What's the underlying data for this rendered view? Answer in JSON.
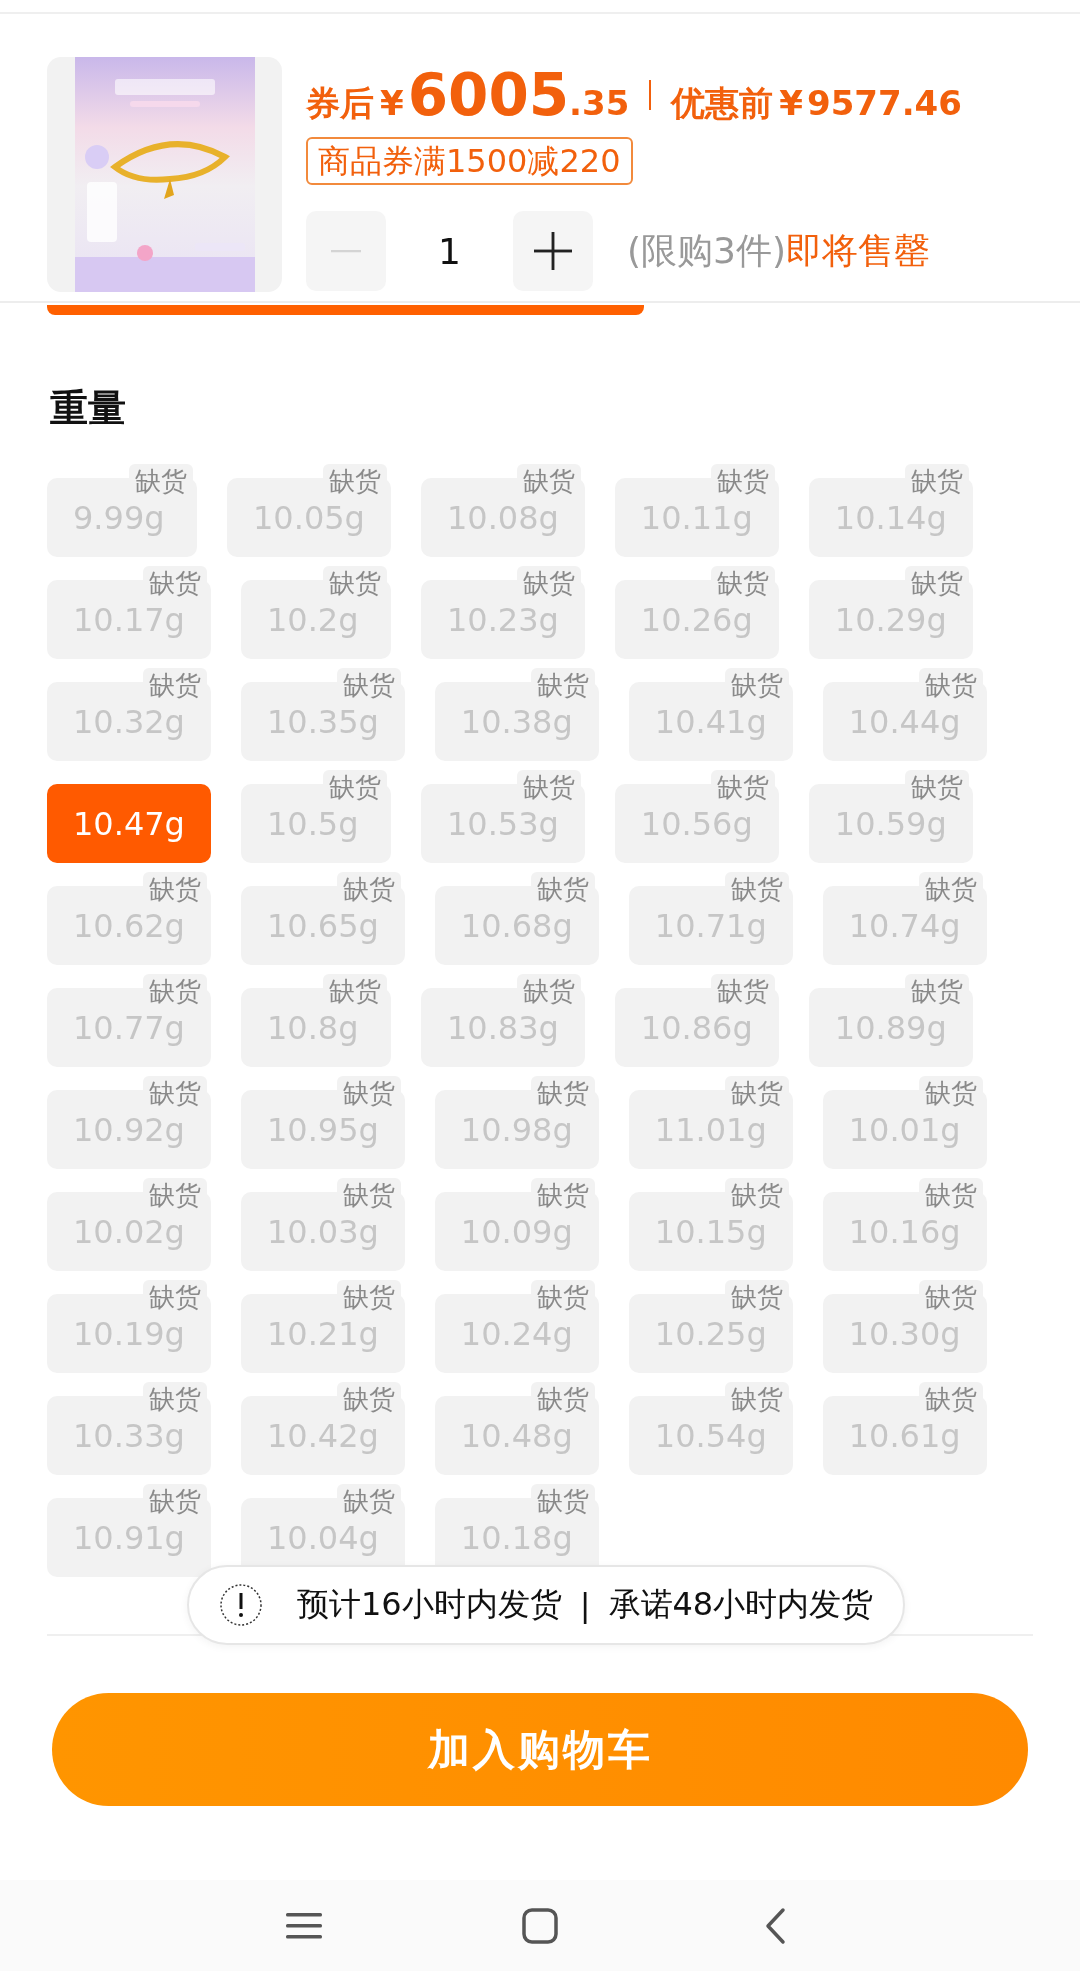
{
  "product": {
    "kind": "picture",
    "price": {
      "prefix": "券后",
      "currency": "¥",
      "integer": "6005",
      "decimal": ".35",
      "original_label": "优惠前",
      "original_currency": "¥",
      "original": "9577.46"
    },
    "coupon": "商品券满1500减220",
    "quantity": {
      "value": "1",
      "minus_disabled": true
    },
    "limit": "(限购3件)",
    "stock_note": "即将售罄"
  },
  "section": {
    "title": "重量"
  },
  "weight_rows": [
    {
      "options": [
        {
          "label": "9.99g",
          "selected": false,
          "badge": "缺货"
        },
        {
          "label": "10.05g",
          "selected": false,
          "badge": "缺货"
        },
        {
          "label": "10.08g",
          "selected": false,
          "badge": "缺货"
        },
        {
          "label": "10.11g",
          "selected": false,
          "badge": "缺货"
        },
        {
          "label": "10.14g",
          "selected": false,
          "badge": "缺货"
        }
      ]
    },
    {
      "options": [
        {
          "label": "10.17g",
          "selected": false,
          "badge": "缺货"
        },
        {
          "label": "10.2g",
          "selected": false,
          "badge": "缺货"
        },
        {
          "label": "10.23g",
          "selected": false,
          "badge": "缺货"
        },
        {
          "label": "10.26g",
          "selected": false,
          "badge": "缺货"
        },
        {
          "label": "10.29g",
          "selected": false,
          "badge": "缺货"
        }
      ]
    },
    {
      "options": [
        {
          "label": "10.32g",
          "selected": false,
          "badge": "缺货"
        },
        {
          "label": "10.35g",
          "selected": false,
          "badge": "缺货"
        },
        {
          "label": "10.38g",
          "selected": false,
          "badge": "缺货"
        },
        {
          "label": "10.41g",
          "selected": false,
          "badge": "缺货"
        },
        {
          "label": "10.44g",
          "selected": false,
          "badge": "缺货"
        }
      ]
    },
    {
      "options": [
        {
          "label": "10.47g",
          "selected": true
        },
        {
          "label": "10.5g",
          "selected": false,
          "badge": "缺货"
        },
        {
          "label": "10.53g",
          "selected": false,
          "badge": "缺货"
        },
        {
          "label": "10.56g",
          "selected": false,
          "badge": "缺货"
        },
        {
          "label": "10.59g",
          "selected": false,
          "badge": "缺货"
        }
      ]
    },
    {
      "options": [
        {
          "label": "10.62g",
          "selected": false,
          "badge": "缺货"
        },
        {
          "label": "10.65g",
          "selected": false,
          "badge": "缺货"
        },
        {
          "label": "10.68g",
          "selected": false,
          "badge": "缺货"
        },
        {
          "label": "10.71g",
          "selected": false,
          "badge": "缺货"
        },
        {
          "label": "10.74g",
          "selected": false,
          "badge": "缺货"
        }
      ]
    },
    {
      "options": [
        {
          "label": "10.77g",
          "selected": false,
          "badge": "缺货"
        },
        {
          "label": "10.8g",
          "selected": false,
          "badge": "缺货"
        },
        {
          "label": "10.83g",
          "selected": false,
          "badge": "缺货"
        },
        {
          "label": "10.86g",
          "selected": false,
          "badge": "缺货"
        },
        {
          "label": "10.89g",
          "selected": false,
          "badge": "缺货"
        }
      ]
    },
    {
      "options": [
        {
          "label": "10.92g",
          "selected": false,
          "badge": "缺货"
        },
        {
          "label": "10.95g",
          "selected": false,
          "badge": "缺货"
        },
        {
          "label": "10.98g",
          "selected": false,
          "badge": "缺货"
        },
        {
          "label": "11.01g",
          "selected": false,
          "badge": "缺货"
        },
        {
          "label": "10.01g",
          "selected": false,
          "badge": "缺货"
        }
      ]
    },
    {
      "options": [
        {
          "label": "10.02g",
          "selected": false,
          "badge": "缺货"
        },
        {
          "label": "10.03g",
          "selected": false,
          "badge": "缺货"
        },
        {
          "label": "10.09g",
          "selected": false,
          "badge": "缺货"
        },
        {
          "label": "10.15g",
          "selected": false,
          "badge": "缺货"
        },
        {
          "label": "10.16g",
          "selected": false,
          "badge": "缺货"
        }
      ]
    },
    {
      "options": [
        {
          "label": "10.19g",
          "selected": false,
          "badge": "缺货"
        },
        {
          "label": "10.21g",
          "selected": false,
          "badge": "缺货"
        },
        {
          "label": "10.24g",
          "selected": false,
          "badge": "缺货"
        },
        {
          "label": "10.25g",
          "selected": false,
          "badge": "缺货"
        },
        {
          "label": "10.30g",
          "selected": false,
          "badge": "缺货"
        }
      ]
    },
    {
      "options": [
        {
          "label": "10.33g",
          "selected": false,
          "badge": "缺货"
        },
        {
          "label": "10.42g",
          "selected": false,
          "badge": "缺货"
        },
        {
          "label": "10.48g",
          "selected": false,
          "badge": "缺货"
        },
        {
          "label": "10.54g",
          "selected": false,
          "badge": "缺货"
        },
        {
          "label": "10.61g",
          "selected": false,
          "badge": "缺货"
        }
      ]
    },
    {
      "options": [
        {
          "label": "10.91g",
          "selected": false,
          "badge": "缺货"
        },
        {
          "label": "10.04g",
          "selected": false,
          "badge": "缺货"
        },
        {
          "label": "10.18g",
          "selected": false,
          "badge": "缺货"
        }
      ]
    }
  ],
  "toast": {
    "text": "预计16小时内发货",
    "separator": "|",
    "text_2": "承诺48小时内发货"
  },
  "add_to_cart": "加入购物车"
}
